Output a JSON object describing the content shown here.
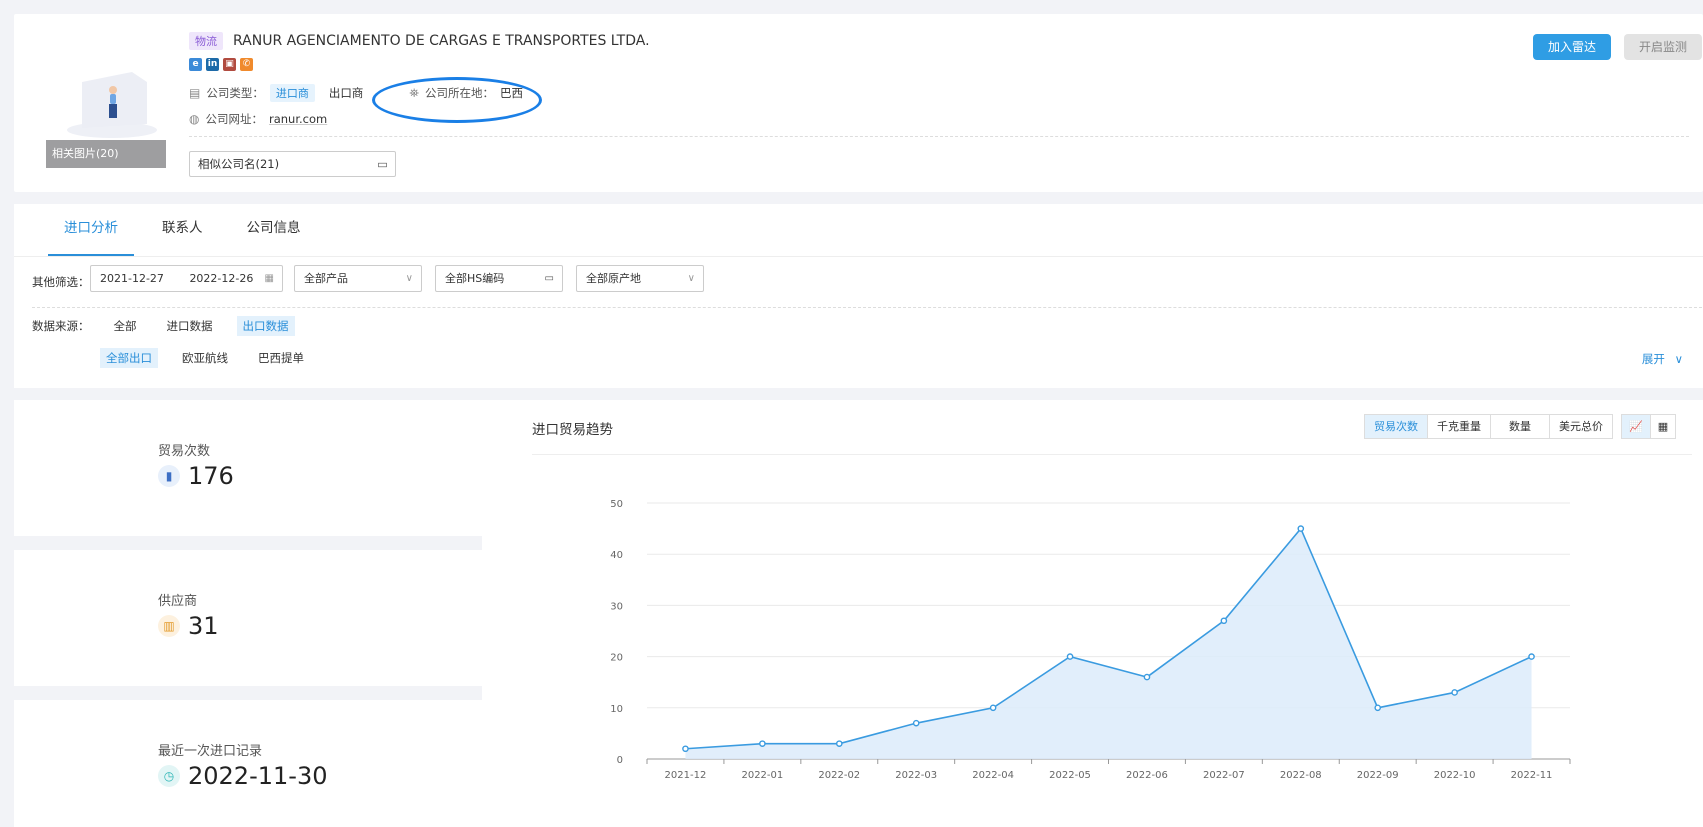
{
  "company": {
    "tag": "物流",
    "name": "RANUR AGENCIAMENTO DE CARGAS E TRANSPORTES LTDA.",
    "photos_label": "相关图片(20)",
    "type_label": "公司类型：",
    "type_importer": "进口商",
    "type_exporter": "出口商",
    "location_label": "公司所在地：",
    "location_value": "巴西",
    "website_label": "公司网址：",
    "website_value": "ranur.com",
    "similar_label": "相似公司名(21)",
    "add_radar": "加入雷达",
    "start_monitor": "开启监测"
  },
  "tabs": [
    "进口分析",
    "联系人",
    "公司信息"
  ],
  "filters": {
    "label": "其他筛选：",
    "date_start": "2021-12-27",
    "date_end": "2022-12-26",
    "product": "全部产品",
    "hs_code": "全部HS编码",
    "origin": "全部原产地",
    "source_label": "数据来源：",
    "sources": [
      "全部",
      "进口数据",
      "出口数据"
    ],
    "subsources": [
      "全部出口",
      "欧亚航线",
      "巴西提单"
    ],
    "expand": "展开"
  },
  "stats": [
    {
      "label": "贸易次数",
      "value": "176"
    },
    {
      "label": "供应商",
      "value": "31"
    },
    {
      "label": "最近一次进口记录",
      "value": "2022-11-30"
    }
  ],
  "chart_panel": {
    "title": "进口贸易趋势",
    "metrics": [
      "贸易次数",
      "千克重量",
      "数量",
      "美元总价"
    ]
  },
  "colors": {
    "accent": "#2a8fd9",
    "primary_button": "#2f9de4",
    "line": "#3a9be0",
    "area": "#dcebfa"
  },
  "chart_data": {
    "type": "area",
    "categories": [
      "2021-12",
      "2022-01",
      "2022-02",
      "2022-03",
      "2022-04",
      "2022-05",
      "2022-06",
      "2022-07",
      "2022-08",
      "2022-09",
      "2022-10",
      "2022-11"
    ],
    "values": [
      2,
      3,
      3,
      7,
      10,
      20,
      16,
      27,
      45,
      10,
      13,
      20
    ],
    "yticks": [
      0,
      10,
      20,
      30,
      40,
      50
    ],
    "ylim": [
      0,
      50
    ],
    "grid": true
  }
}
